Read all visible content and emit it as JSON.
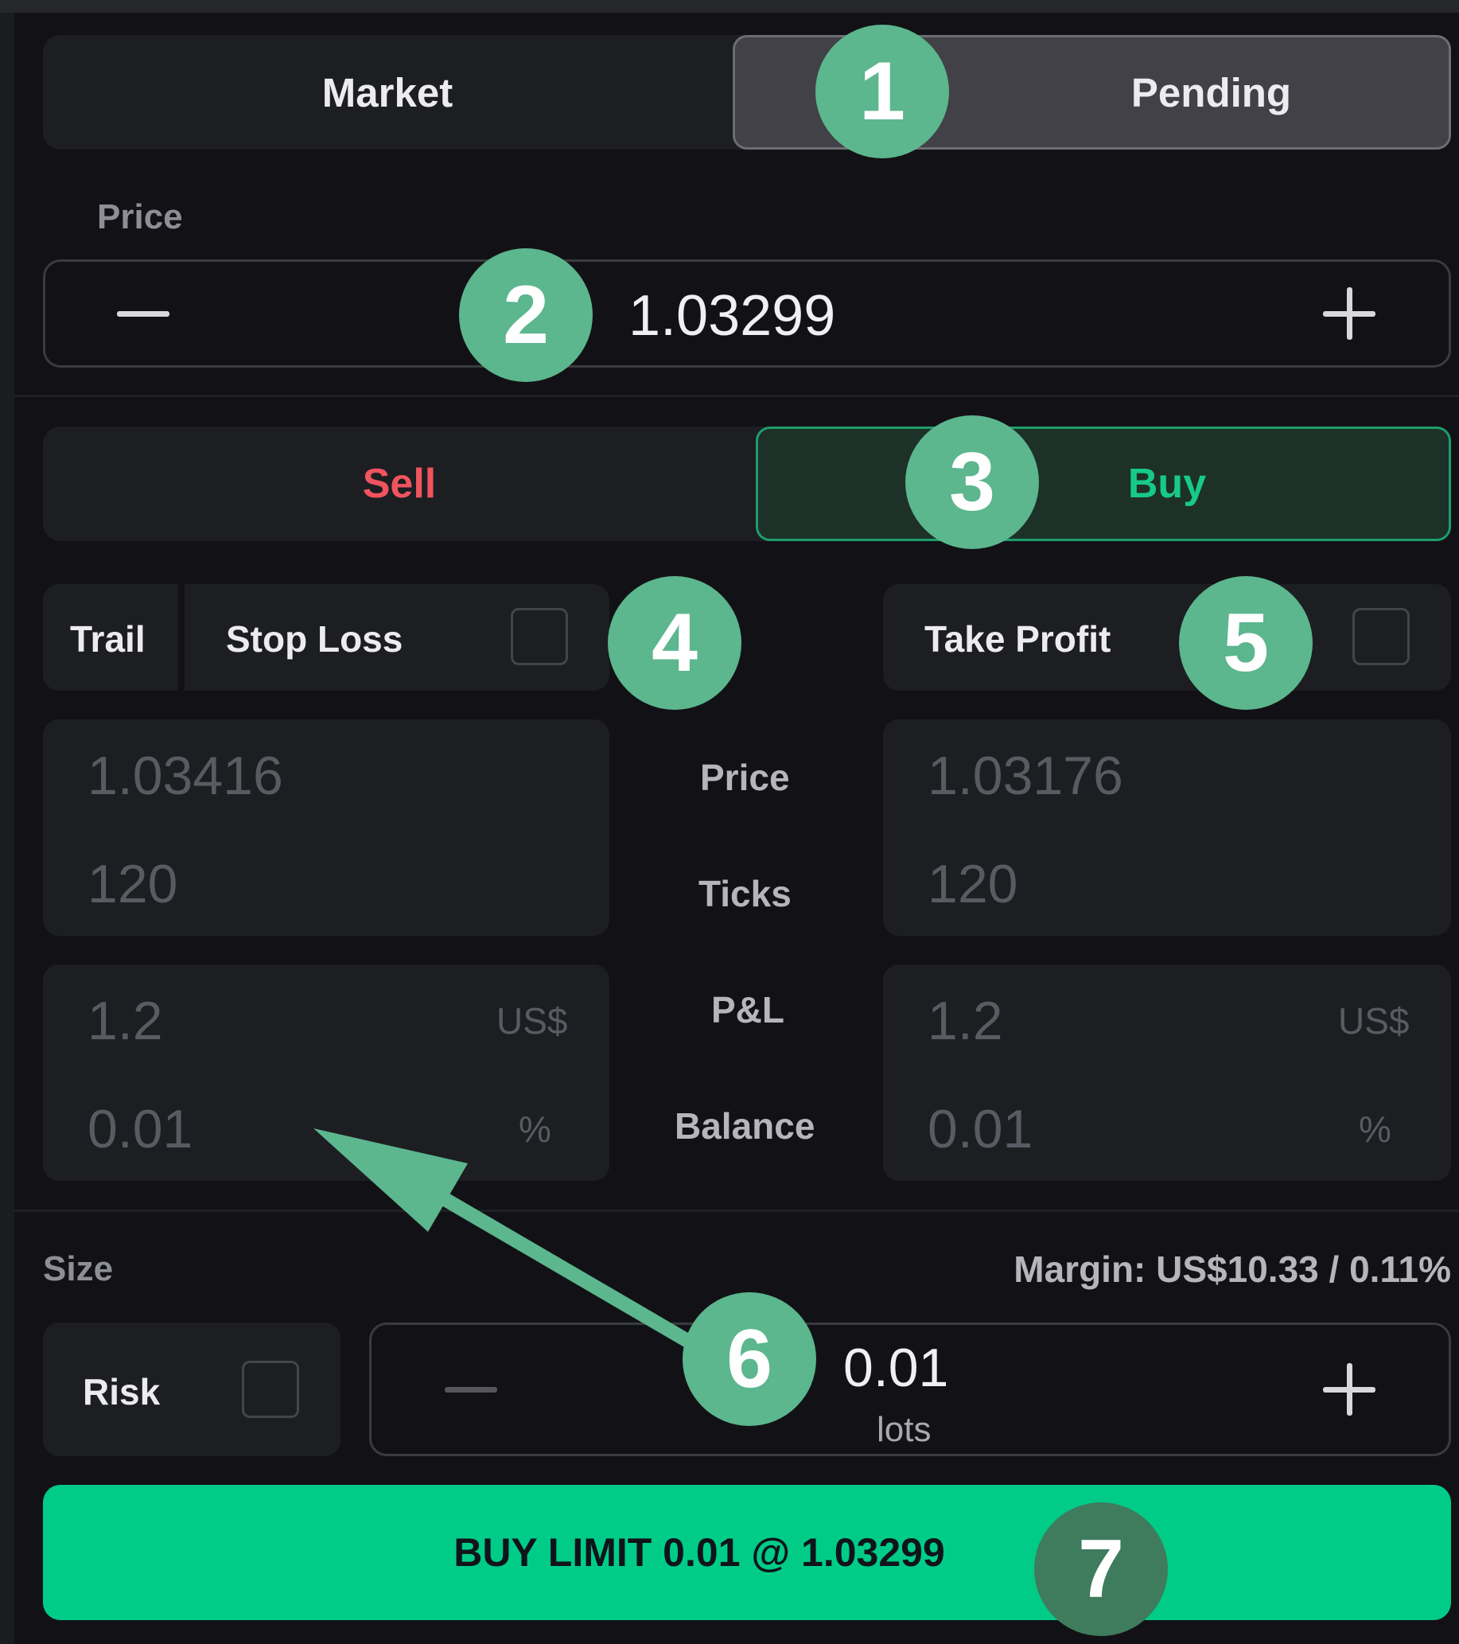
{
  "order_type": {
    "market_label": "Market",
    "pending_label": "Pending",
    "selected": "Pending"
  },
  "price": {
    "label": "Price",
    "value": "1.03299"
  },
  "side": {
    "sell_label": "Sell",
    "buy_label": "Buy",
    "selected": "Buy"
  },
  "stop_loss": {
    "trail_label": "Trail",
    "label": "Stop Loss",
    "checked": false,
    "price": "1.03416",
    "ticks": "120",
    "pnl": "1.2",
    "pnl_unit": "US$",
    "balance": "0.01",
    "balance_unit": "%"
  },
  "take_profit": {
    "label": "Take Profit",
    "checked": false,
    "price": "1.03176",
    "ticks": "120",
    "pnl": "1.2",
    "pnl_unit": "US$",
    "balance": "0.01",
    "balance_unit": "%"
  },
  "row_labels": {
    "price": "Price",
    "ticks": "Ticks",
    "pnl": "P&L",
    "balance": "Balance"
  },
  "size": {
    "label": "Size",
    "margin": "Margin: US$10.33 / 0.11%",
    "risk_label": "Risk",
    "risk_checked": false,
    "value": "0.01",
    "unit": "lots"
  },
  "submit": {
    "label": "BUY LIMIT 0.01 @ 1.03299"
  },
  "annotations": [
    "1",
    "2",
    "3",
    "4",
    "5",
    "6",
    "7"
  ],
  "colors": {
    "background": "#121216",
    "sell": "#f0545e",
    "buy": "#17c98a",
    "submit": "#00cc88",
    "annotation": "#5cb68e",
    "annotation_dark": "#3f7b5d"
  }
}
